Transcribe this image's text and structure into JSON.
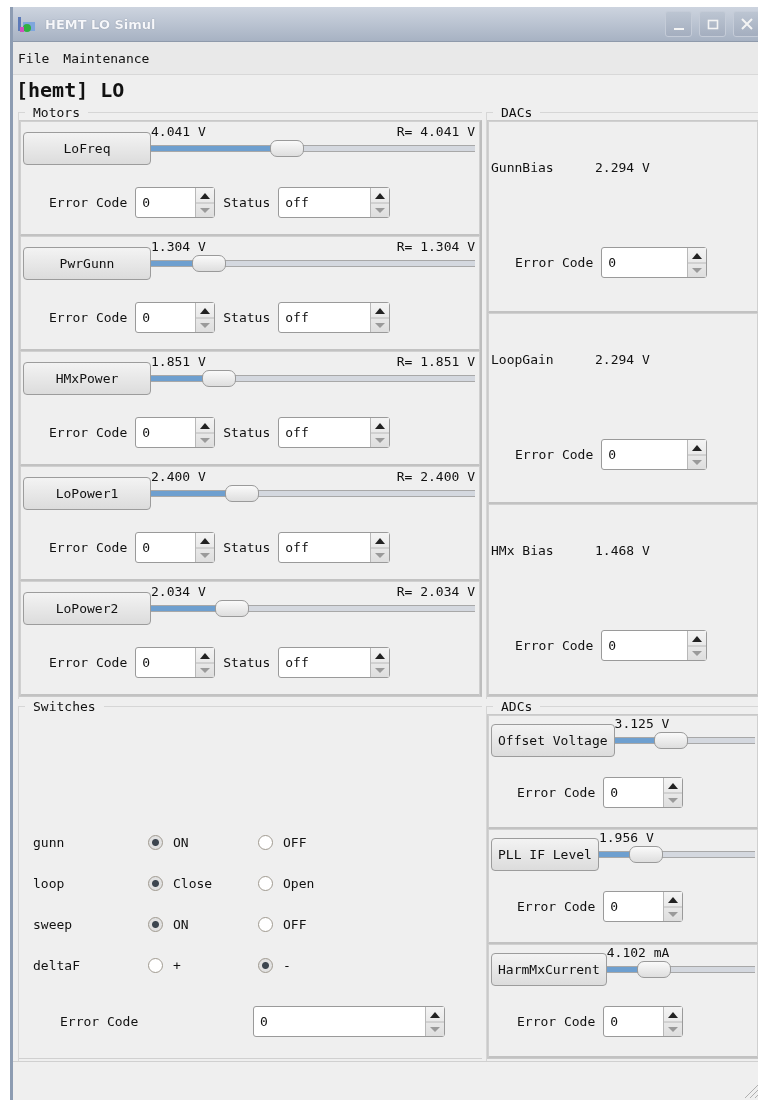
{
  "window": {
    "title": "HEMT LO Simul"
  },
  "menu": [
    {
      "label": "File"
    },
    {
      "label": "Maintenance"
    }
  ],
  "heading": "[hemt] LO",
  "motors": {
    "title": "Motors",
    "items": [
      {
        "name": "LoFreq",
        "reading": "4.041 V",
        "readback": "R= 4.041 V",
        "level": 0.42,
        "error_label": "Error Code",
        "error_code": "0",
        "status_label": "Status",
        "status": "off"
      },
      {
        "name": "PwrGunn",
        "reading": "1.304 V",
        "readback": "R= 1.304 V",
        "level": 0.18,
        "error_label": "Error Code",
        "error_code": "0",
        "status_label": "Status",
        "status": "off"
      },
      {
        "name": "HMxPower",
        "reading": "1.851 V",
        "readback": "R= 1.851 V",
        "level": 0.21,
        "error_label": "Error Code",
        "error_code": "0",
        "status_label": "Status",
        "status": "off"
      },
      {
        "name": "LoPower1",
        "reading": "2.400 V",
        "readback": "R= 2.400 V",
        "level": 0.28,
        "error_label": "Error Code",
        "error_code": "0",
        "status_label": "Status",
        "status": "off"
      },
      {
        "name": "LoPower2",
        "reading": "2.034 V",
        "readback": "R= 2.034 V",
        "level": 0.25,
        "error_label": "Error Code",
        "error_code": "0",
        "status_label": "Status",
        "status": "off"
      }
    ]
  },
  "dacs": {
    "title": "DACs",
    "items": [
      {
        "name": "GunnBias",
        "reading": "2.294 V",
        "error_label": "Error Code",
        "error_code": "0"
      },
      {
        "name": "LoopGain",
        "reading": "2.294 V",
        "error_label": "Error Code",
        "error_code": "0"
      },
      {
        "name": "HMx Bias",
        "reading": "1.468 V",
        "error_label": "Error Code",
        "error_code": "0"
      }
    ]
  },
  "switches": {
    "title": "Switches",
    "rows": [
      {
        "name": "gunn",
        "options": [
          {
            "label": "ON",
            "selected": true
          },
          {
            "label": "OFF",
            "selected": false
          }
        ]
      },
      {
        "name": "loop",
        "options": [
          {
            "label": "Close",
            "selected": true
          },
          {
            "label": "Open",
            "selected": false
          }
        ]
      },
      {
        "name": "sweep",
        "options": [
          {
            "label": "ON",
            "selected": true
          },
          {
            "label": "OFF",
            "selected": false
          }
        ]
      },
      {
        "name": "deltaF",
        "options": [
          {
            "label": "+",
            "selected": false
          },
          {
            "label": "-",
            "selected": true
          }
        ]
      }
    ],
    "error_label": "Error Code",
    "error_code": "0"
  },
  "adcs": {
    "title": "ADCs",
    "items": [
      {
        "name": "Offset Voltage",
        "reading": "3.125 V",
        "level": 0.4,
        "error_label": "Error Code",
        "error_code": "0"
      },
      {
        "name": "PLL IF Level",
        "reading": "1.956 V",
        "level": 0.3,
        "error_label": "Error Code",
        "error_code": "0"
      },
      {
        "name": "HarmMxCurrent",
        "reading": "4.102 mA",
        "level": 0.32,
        "error_label": "Error Code",
        "error_code": "0"
      }
    ]
  }
}
